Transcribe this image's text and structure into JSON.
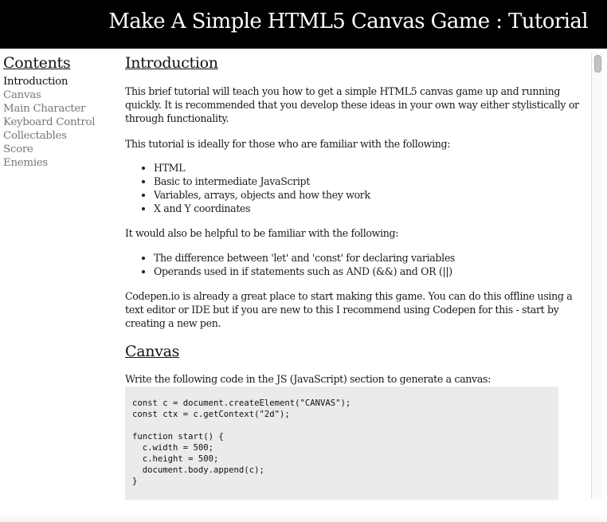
{
  "header": {
    "title": "Make A Simple HTML5 Canvas Game : Tutorial"
  },
  "sidebar": {
    "title": "Contents",
    "items": [
      {
        "label": "Introduction",
        "active": true
      },
      {
        "label": "Canvas",
        "active": false
      },
      {
        "label": "Main Character",
        "active": false
      },
      {
        "label": "Keyboard Control",
        "active": false
      },
      {
        "label": "Collectables",
        "active": false
      },
      {
        "label": "Score",
        "active": false
      },
      {
        "label": "Enemies",
        "active": false
      }
    ]
  },
  "main": {
    "introduction": {
      "heading": "Introduction",
      "p1": "This brief tutorial will teach you how to get a simple HTML5 canvas game up and running quickly. It is recommended that you develop these ideas in your own way either stylistically or through functionality.",
      "p2": "This tutorial is ideally for those who are familiar with the following:",
      "list1": [
        "HTML",
        "Basic to intermediate JavaScript",
        "Variables, arrays, objects and how they work",
        "X and Y coordinates"
      ],
      "p3": "It would also be helpful to be familiar with the following:",
      "list2": [
        "The difference between 'let' and 'const' for declaring variables",
        "Operands used in if statements such as AND (&&) and OR (||)"
      ],
      "p4": "Codepen.io is already a great place to start making this game. You can do this offline using a text editor or IDE but if you are new to this I recommend using Codepen for this - start by creating a new pen."
    },
    "canvas": {
      "heading": "Canvas",
      "p1": "Write the following code in the JS (JavaScript) section to generate a canvas:",
      "code": [
        "const c = document.createElement(\"CANVAS\");",
        "const ctx = c.getContext(\"2d\");",
        "",
        "function start() {",
        "  c.width = 500;",
        "  c.height = 500;",
        "  document.body.append(c);",
        "}"
      ]
    }
  }
}
